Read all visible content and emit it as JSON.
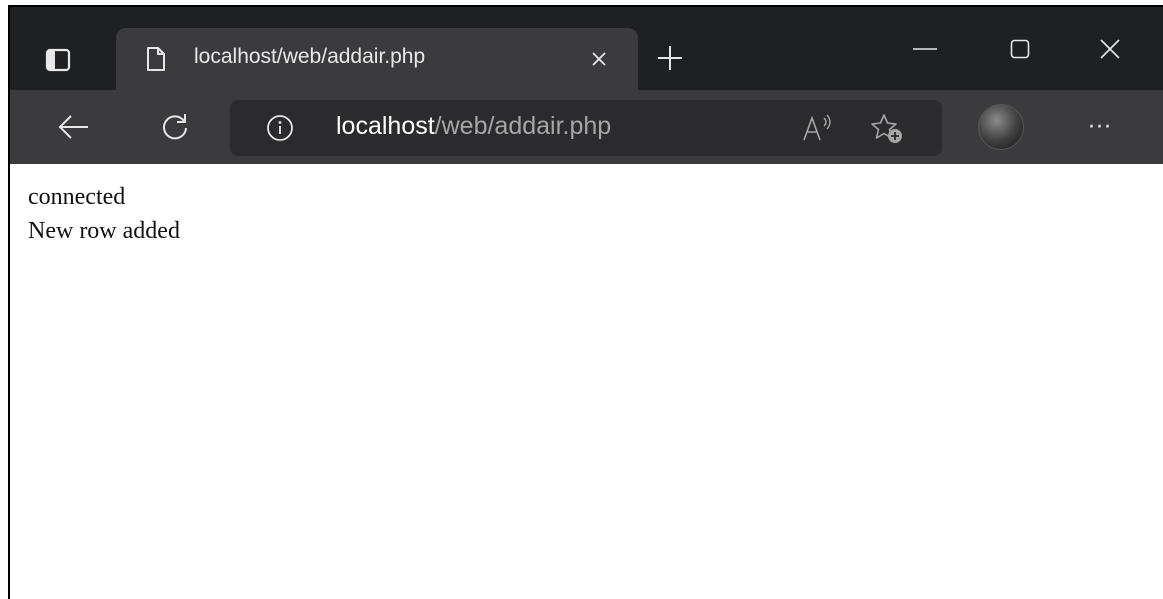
{
  "tab": {
    "title": "localhost/web/addair.php",
    "close_glyph": "✕",
    "new_tab_glyph": "+"
  },
  "window_controls": {
    "minimize_glyph": "—",
    "maximize_glyph": "▢",
    "close_glyph": "✕"
  },
  "address": {
    "host": "localhost",
    "path": "/web/addair.php"
  },
  "toolbar": {
    "more_glyph": "···"
  },
  "content": {
    "lines": [
      "connected",
      "New row added"
    ]
  },
  "theme": {
    "tabstrip_bg": "#1f2024",
    "toolbar_bg": "#3b3b3d",
    "address_bg": "#2b2b2d",
    "icon_color": "#e8e8e8"
  },
  "icons": [
    "tab-actions-icon",
    "page-icon",
    "back-arrow-icon",
    "refresh-icon",
    "info-icon",
    "read-aloud-icon",
    "add-favorite-icon",
    "profile-avatar"
  ]
}
